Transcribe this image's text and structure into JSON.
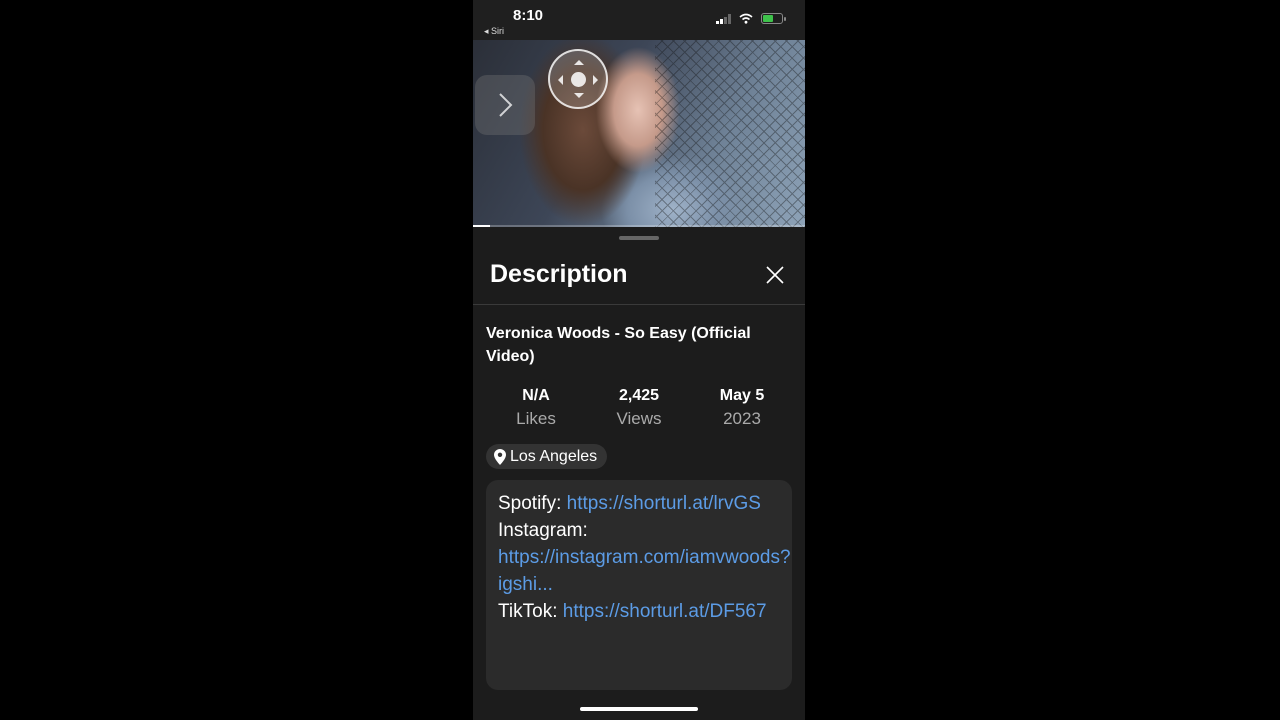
{
  "status_bar": {
    "time": "8:10",
    "back_app": "◂ Siri",
    "battery_color": "#3ec24b"
  },
  "player": {
    "progress_fraction": 0.05,
    "nav_icon": "directional-pad-icon",
    "side_icon": "chevron-right-icon"
  },
  "sheet": {
    "title": "Description",
    "close_icon": "close-icon"
  },
  "video": {
    "title": "Veronica Woods - So Easy (Official Video)",
    "stats": [
      {
        "value": "N/A",
        "label": "Likes"
      },
      {
        "value": "2,425",
        "label": "Views"
      },
      {
        "value": "May 5",
        "label": "2023"
      }
    ],
    "location": "Los Angeles"
  },
  "description": {
    "lines": [
      {
        "prefix": "Spotify: ",
        "link": "https://shorturl.at/lrvGS"
      },
      {
        "prefix": "Instagram: ",
        "link": "https://instagram.com/iamvwoods?igshi..."
      },
      {
        "prefix": "TikTok: ",
        "link": "https://shorturl.at/DF567"
      }
    ],
    "link_color": "#5c9ce6"
  }
}
